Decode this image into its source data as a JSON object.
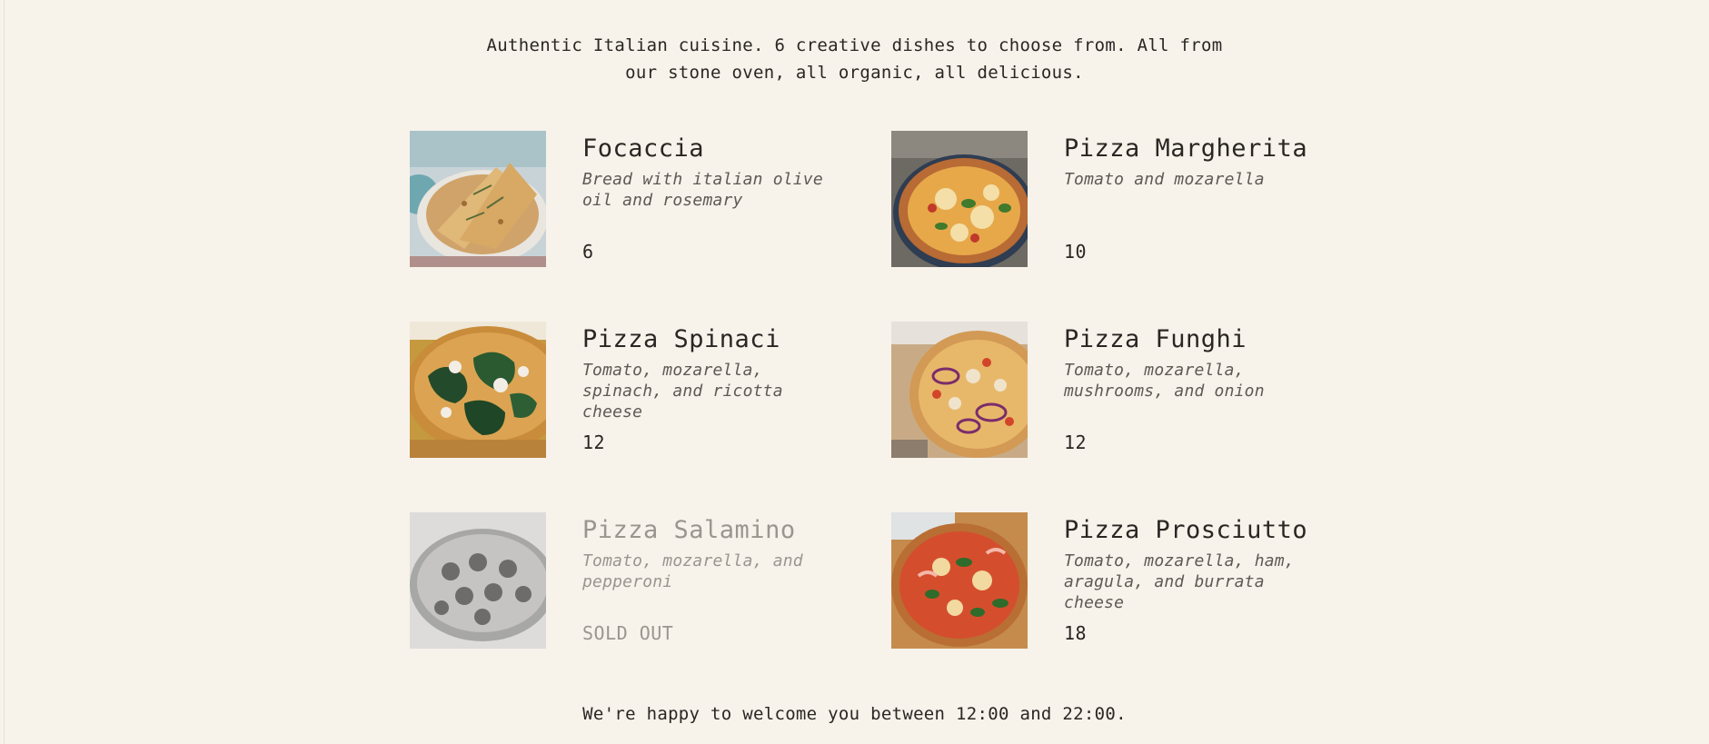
{
  "intro": {
    "line1": "Authentic Italian cuisine. 6 creative dishes to choose from. All from",
    "line2": "our stone oven, all organic, all delicious."
  },
  "menu": {
    "items": [
      {
        "name": "Focaccia",
        "ingredients": "Bread with italian olive oil and rosemary",
        "price": "6",
        "image_icon": "focaccia-photo",
        "sold_out": false
      },
      {
        "name": "Pizza Margherita",
        "ingredients": "Tomato and mozarella",
        "price": "10",
        "image_icon": "pizza-margherita-photo",
        "sold_out": false
      },
      {
        "name": "Pizza Spinaci",
        "ingredients": "Tomato, mozarella, spinach, and ricotta cheese",
        "price": "12",
        "image_icon": "pizza-spinaci-photo",
        "sold_out": false
      },
      {
        "name": "Pizza Funghi",
        "ingredients": "Tomato, mozarella, mushrooms, and onion",
        "price": "12",
        "image_icon": "pizza-funghi-photo",
        "sold_out": false
      },
      {
        "name": "Pizza Salamino",
        "ingredients": "Tomato, mozarella, and pepperoni",
        "price": "SOLD OUT",
        "image_icon": "pizza-salamino-photo",
        "sold_out": true
      },
      {
        "name": "Pizza Prosciutto",
        "ingredients": "Tomato, mozarella, ham, aragula, and burrata cheese",
        "price": "18",
        "image_icon": "pizza-prosciutto-photo",
        "sold_out": false
      }
    ]
  },
  "footer": {
    "text": "We're happy to welcome you between 12:00 and 22:00."
  },
  "colors": {
    "background": "#f7f2ea",
    "text": "#2a2622",
    "muted": "#9a958e"
  }
}
